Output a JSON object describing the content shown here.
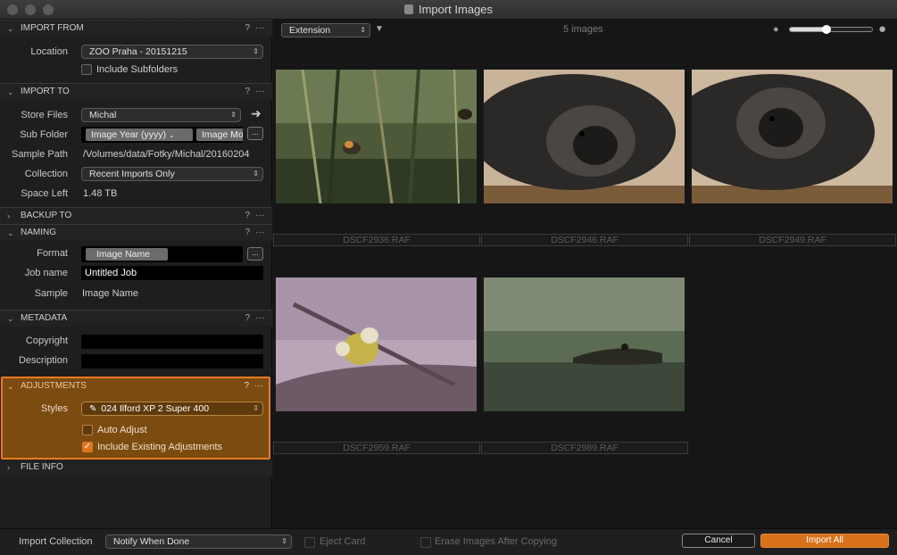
{
  "window": {
    "title": "Import Images"
  },
  "import_from": {
    "header": "IMPORT FROM",
    "location_label": "Location",
    "location_value": "ZOO Praha - 20151215",
    "include_subfolders_label": "Include Subfolders"
  },
  "import_to": {
    "header": "IMPORT TO",
    "store_files_label": "Store Files",
    "store_files_value": "Michal",
    "sub_folder_label": "Sub Folder",
    "sub_folder_token1": "Image Year (yyyy)",
    "sub_folder_token2": "Image Mo",
    "sample_path_label": "Sample Path",
    "sample_path_value": "/Volumes/data/Fotky/Michal/20160204",
    "collection_label": "Collection",
    "collection_value": "Recent Imports Only",
    "space_left_label": "Space Left",
    "space_left_value": "1.48 TB"
  },
  "backup_to": {
    "header": "BACKUP TO"
  },
  "naming": {
    "header": "NAMING",
    "format_label": "Format",
    "format_token": "Image Name",
    "job_name_label": "Job name",
    "job_name_value": "Untitled Job",
    "sample_label": "Sample",
    "sample_value": "Image Name"
  },
  "metadata": {
    "header": "METADATA",
    "copyright_label": "Copyright",
    "copyright_value": "",
    "description_label": "Description",
    "description_value": ""
  },
  "adjustments": {
    "header": "ADJUSTMENTS",
    "styles_label": "Styles",
    "styles_value": "024 Ilford XP 2 Super 400",
    "auto_adjust_label": "Auto Adjust",
    "include_existing_label": "Include Existing Adjustments"
  },
  "file_info": {
    "header": "FILE INFO"
  },
  "common": {
    "help": "?",
    "more": "···",
    "browse": "..."
  },
  "browser": {
    "sort_value": "Extension",
    "image_count": "5 images",
    "images": [
      {
        "name": "DSCF2936.RAF"
      },
      {
        "name": "DSCF2946.RAF"
      },
      {
        "name": "DSCF2949.RAF"
      },
      {
        "name": "DSCF2959.RAF"
      },
      {
        "name": "DSCF2989.RAF"
      }
    ]
  },
  "footer": {
    "import_collection_label": "Import Collection",
    "notify_value": "Notify When Done",
    "eject_card_label": "Eject Card",
    "erase_images_label": "Erase Images After Copying",
    "cancel_label": "Cancel",
    "import_all_label": "Import All"
  },
  "colors": {
    "accent": "#e0761c",
    "adjustments_bg": "#7b4b0f",
    "selection_border": "#ea7a22"
  }
}
